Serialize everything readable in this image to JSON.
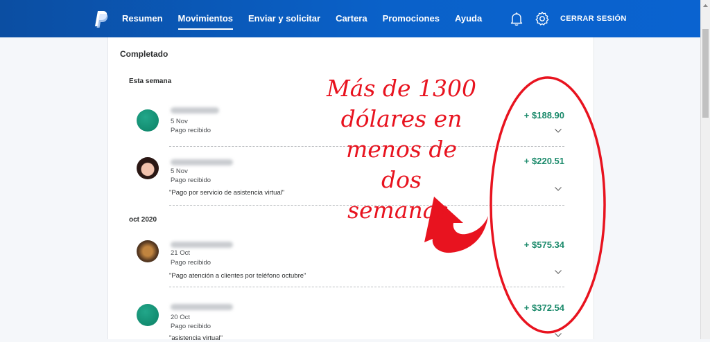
{
  "nav": {
    "items": [
      {
        "label": "Resumen",
        "active": false
      },
      {
        "label": "Movimientos",
        "active": true
      },
      {
        "label": "Enviar y solicitar",
        "active": false
      },
      {
        "label": "Cartera",
        "active": false
      },
      {
        "label": "Promociones",
        "active": false
      },
      {
        "label": "Ayuda",
        "active": false
      }
    ],
    "logout_label": "CERRAR SESIÓN",
    "icons": [
      "paypal-logo",
      "bell-icon",
      "gear-icon"
    ]
  },
  "activity": {
    "section_title": "Completado",
    "groups": [
      {
        "label": "Esta semana",
        "transactions": [
          {
            "date": "5 Nov",
            "status": "Pago recibido",
            "note": "",
            "amount": "+ $188.90",
            "avatar": "green"
          },
          {
            "date": "5 Nov",
            "status": "Pago recibido",
            "note": "\"Pago por servicio de asistencia virtual\"",
            "amount": "+ $220.51",
            "avatar": "photo"
          }
        ]
      },
      {
        "label": "oct 2020",
        "transactions": [
          {
            "date": "21 Oct",
            "status": "Pago recibido",
            "note": "\"Pago atención a clientes por teléfono octubre\"",
            "amount": "+ $575.34",
            "avatar": "photo"
          },
          {
            "date": "20 Oct",
            "status": "Pago recibido",
            "note": "\"asistencia virtual\"",
            "amount": "+ $372.54",
            "avatar": "green"
          }
        ]
      }
    ]
  },
  "annotation": {
    "text_lines": [
      "Más de 1300",
      "dólares en",
      "menos de dos",
      "semanas."
    ],
    "color": "#e8131f"
  },
  "colors": {
    "header": "#0a5bbf",
    "amount": "#1b8a6b",
    "annotation": "#e8131f"
  }
}
